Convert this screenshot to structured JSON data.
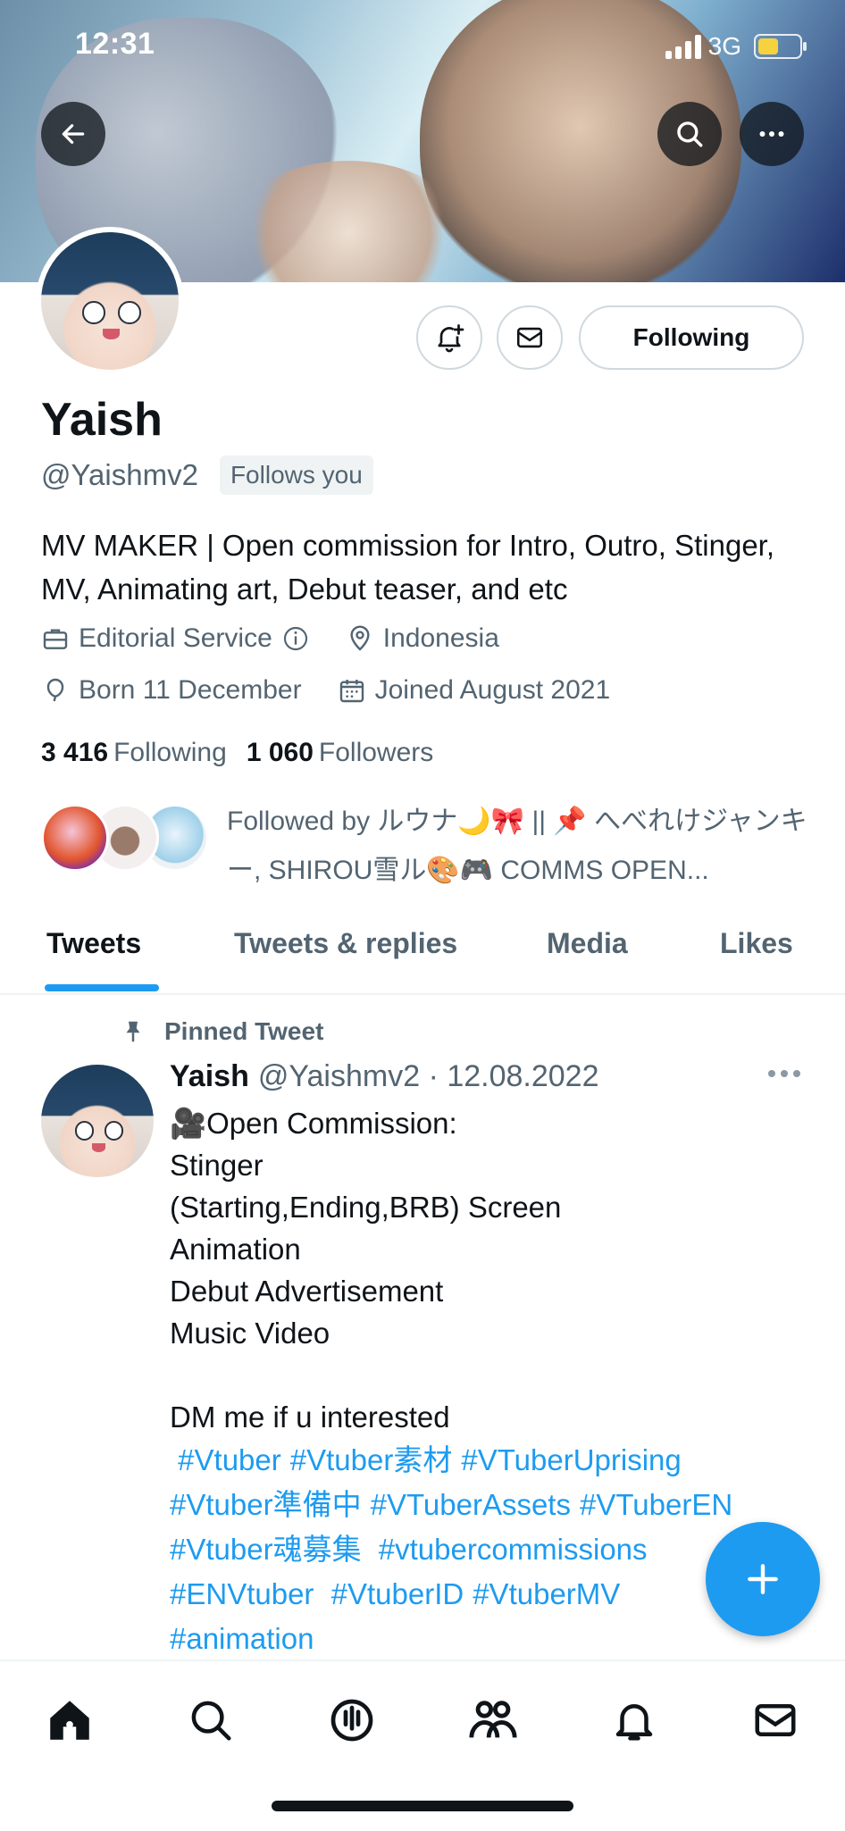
{
  "status_bar": {
    "time": "12:31",
    "network": "3G"
  },
  "profile": {
    "name": "Yaish",
    "handle": "@Yaishmv2",
    "follows_you": "Follows you",
    "bio": "MV MAKER | Open commission for Intro, Outro, Stinger, MV, Animating art, Debut teaser, and etc",
    "category": "Editorial Service",
    "location": "Indonesia",
    "born": "Born 11 December",
    "joined": "Joined August 2021",
    "following_count": "3 416",
    "following_label": "Following",
    "followers_count": "1 060",
    "followers_label": "Followers",
    "followed_by": "Followed by ルウナ🌙🎀 || 📌 へべれけジャンキー, SHIROU雪ル🎨🎮 COMMS OPEN..."
  },
  "actions": {
    "following_button": "Following"
  },
  "tabs": [
    {
      "label": "Tweets"
    },
    {
      "label": "Tweets & replies"
    },
    {
      "label": "Media"
    },
    {
      "label": "Likes"
    }
  ],
  "pinned_tweet": {
    "pinned_label": "Pinned Tweet",
    "author_name": "Yaish",
    "author_meta": "@Yaishmv2 · 12.08.2022",
    "lines": [
      "🎥Open Commission:",
      "Stinger",
      "(Starting,Ending,BRB) Screen",
      "Animation",
      "Debut Advertisement",
      "Music Video",
      "",
      "DM me if u interested"
    ],
    "hashtags": [
      "#Vtuber",
      "#Vtuber素材",
      "#VTuberUprising",
      "#Vtuber準備中",
      "#VTuberAssets",
      "#VTuberEN",
      "#Vtuber魂募集",
      "#vtubercommissions",
      "#ENVtuber",
      "#VtuberID",
      "#VtuberMV",
      "#animation"
    ]
  },
  "colors": {
    "accent": "#1d9bf0",
    "text": "#0f1419",
    "secondary": "#536471"
  }
}
